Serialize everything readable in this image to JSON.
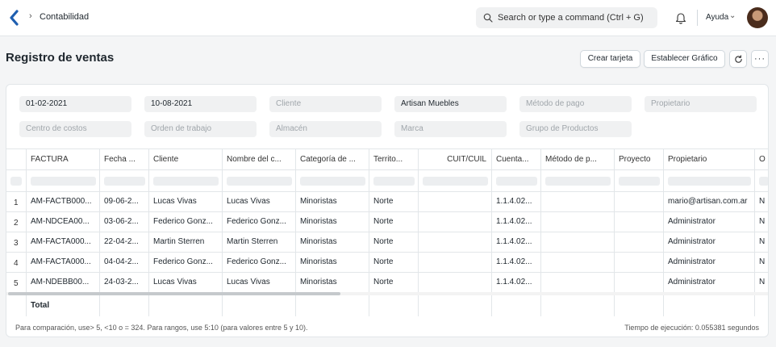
{
  "navbar": {
    "breadcrumb": "Contabilidad",
    "search_placeholder": "Search or type a command (Ctrl + G)",
    "help_label": "Ayuda"
  },
  "page": {
    "title": "Registro de ventas",
    "buttons": {
      "crear_tarjeta": "Crear tarjeta",
      "establecer_grafico": "Establecer Gráfico",
      "more": "···"
    }
  },
  "filters": [
    {
      "value": "01-02-2021",
      "placeholder": ""
    },
    {
      "value": "10-08-2021",
      "placeholder": ""
    },
    {
      "value": "",
      "placeholder": "Cliente"
    },
    {
      "value": "Artisan Muebles",
      "placeholder": ""
    },
    {
      "value": "",
      "placeholder": "Método de pago"
    },
    {
      "value": "",
      "placeholder": "Propietario"
    },
    {
      "value": "",
      "placeholder": "Centro de costos"
    },
    {
      "value": "",
      "placeholder": "Orden de trabajo"
    },
    {
      "value": "",
      "placeholder": "Almacén"
    },
    {
      "value": "",
      "placeholder": "Marca"
    },
    {
      "value": "",
      "placeholder": "Grupo de Productos"
    }
  ],
  "table": {
    "columns": [
      "FACTURA",
      "Fecha ...",
      "Cliente",
      "Nombre del c...",
      "Categoría de ...",
      "Territo...",
      "CUIT/CUIL",
      "Cuenta...",
      "Método de p...",
      "Proyecto",
      "Propietario",
      "O"
    ],
    "rows": [
      {
        "num": "1",
        "cells": [
          "AM-FACTB000...",
          "09-06-2...",
          "Lucas Vivas",
          "Lucas Vivas",
          "Minoristas",
          "Norte",
          "",
          "1.1.4.02...",
          "",
          "",
          "mario@artisan.com.ar",
          "N"
        ]
      },
      {
        "num": "2",
        "cells": [
          "AM-NDCEA00...",
          "03-06-2...",
          "Federico Gonz...",
          "Federico Gonz...",
          "Minoristas",
          "Norte",
          "",
          "1.1.4.02...",
          "",
          "",
          "Administrator",
          "N"
        ]
      },
      {
        "num": "3",
        "cells": [
          "AM-FACTA000...",
          "22-04-2...",
          "Martin Sterren",
          "Martin Sterren",
          "Minoristas",
          "Norte",
          "",
          "1.1.4.02...",
          "",
          "",
          "Administrator",
          "N"
        ]
      },
      {
        "num": "4",
        "cells": [
          "AM-FACTA000...",
          "04-04-2...",
          "Federico Gonz...",
          "Federico Gonz...",
          "Minoristas",
          "Norte",
          "",
          "1.1.4.02...",
          "",
          "",
          "Administrator",
          "N"
        ]
      },
      {
        "num": "5",
        "cells": [
          "AM-NDEBB00...",
          "24-03-2...",
          "Lucas Vivas",
          "Lucas Vivas",
          "Minoristas",
          "Norte",
          "",
          "1.1.4.02...",
          "",
          "",
          "Administrator",
          "N"
        ]
      }
    ],
    "total_label": "Total"
  },
  "footer": {
    "hint": "Para comparación, use> 5, <10 o = 324. Para rangos, use 5:10 (para valores entre 5 y 10).",
    "exec_time": "Tiempo de ejecución: 0.055381 segundos"
  }
}
